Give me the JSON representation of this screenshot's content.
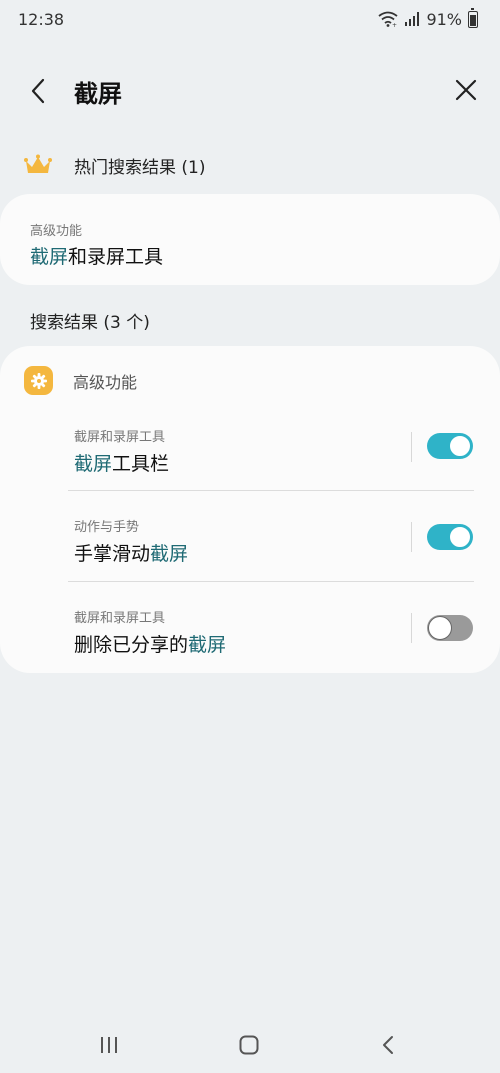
{
  "status_bar": {
    "time": "12:38",
    "battery": "91%",
    "battery_level": 0.91
  },
  "header": {
    "title": "截屏"
  },
  "popular": {
    "header": "热门搜索结果 (1)",
    "item": {
      "category": "高级功能",
      "highlight": "截屏",
      "rest": "和录屏工具"
    }
  },
  "results": {
    "header": "搜索结果 (3 个)",
    "section": "高级功能",
    "items": [
      {
        "category": "截屏和录屏工具",
        "before": "",
        "highlight": "截屏",
        "after": "工具栏",
        "toggle_on": true
      },
      {
        "category": "动作与手势",
        "before": "手掌滑动",
        "highlight": "截屏",
        "after": "",
        "toggle_on": true
      },
      {
        "category": "截屏和录屏工具",
        "before": "删除已分享的",
        "highlight": "截屏",
        "after": "",
        "toggle_on": false
      }
    ]
  },
  "icons": {
    "back": "arrow-back-icon",
    "close": "close-icon",
    "crown": "crown-icon",
    "settings": "gear-icon",
    "recents": "recents-icon",
    "home": "home-icon",
    "nav_back": "nav-back-icon"
  },
  "colors": {
    "background": "#edf0f2",
    "card": "#fbfbfb",
    "highlight": "#1f6a74",
    "toggle_on": "#2fb3c8",
    "toggle_off": "#9a9a9a",
    "crown": "#f4b73f"
  }
}
